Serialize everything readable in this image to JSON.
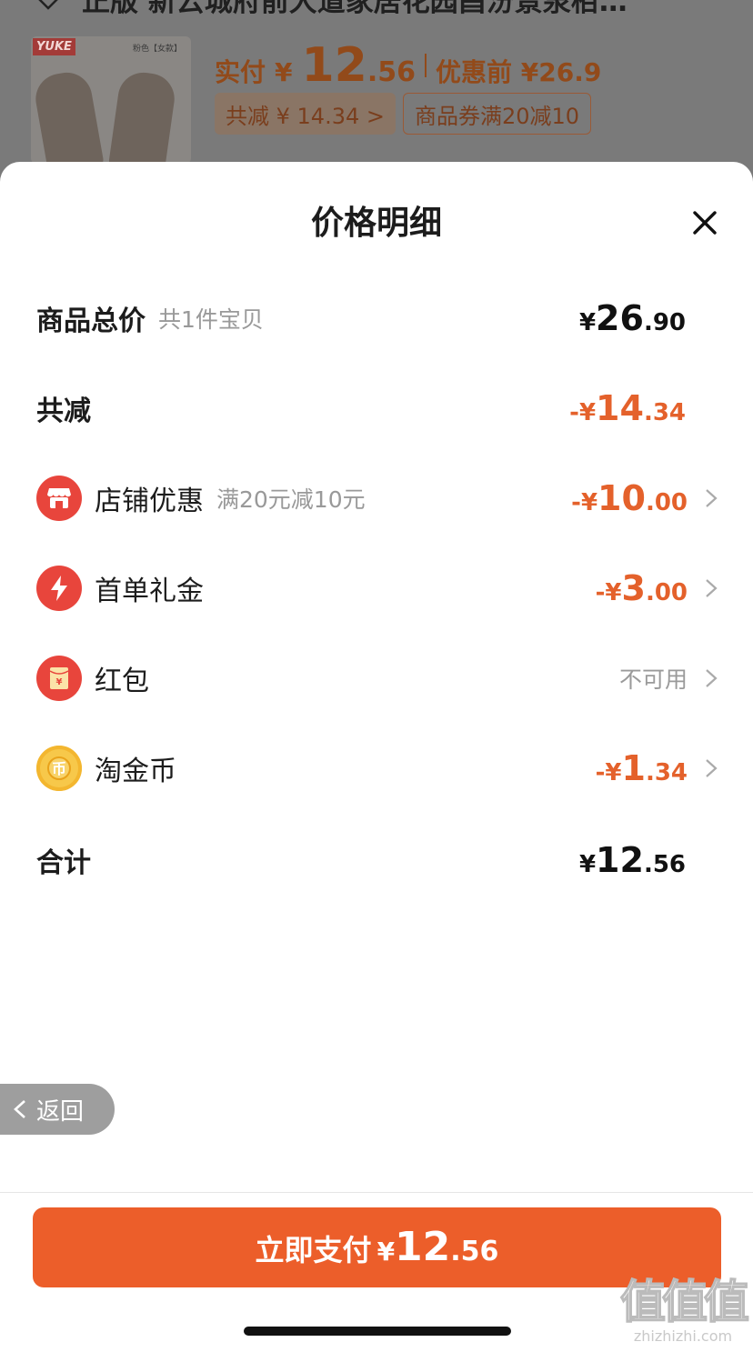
{
  "background": {
    "product_title": "正版 新云城府前大道家居花园昌汾景泉栢…",
    "brand": "YUKE",
    "thumb_label": "粉色【女款】",
    "price_label": "实付",
    "price_currency": "¥",
    "price_int": "12",
    "price_dec": ".56",
    "original_price": "优惠前 ¥26.9",
    "tags": [
      "共减 ¥ 14.34 >",
      "商品券满20减10"
    ]
  },
  "sheet": {
    "title": "价格明细",
    "close_icon": "close-icon",
    "rows": {
      "total": {
        "label": "商品总价",
        "sub": "共1件宝贝",
        "cur": "¥",
        "int": "26",
        "dec": ".90"
      },
      "discount": {
        "label": "共减",
        "cur": "-¥",
        "int": "14",
        "dec": ".34"
      },
      "shop": {
        "label": "店铺优惠",
        "sub": "满20元减10元",
        "cur": "-¥",
        "int": "10",
        "dec": ".00",
        "icon": "shop-icon"
      },
      "first_order": {
        "label": "首单礼金",
        "cur": "-¥",
        "int": "3",
        "dec": ".00",
        "icon": "lightning-icon"
      },
      "red_packet": {
        "label": "红包",
        "value": "不可用",
        "icon": "red-packet-icon"
      },
      "coin": {
        "label": "淘金币",
        "cur": "-¥",
        "int": "1",
        "dec": ".34",
        "icon": "coin-icon"
      },
      "sum": {
        "label": "合计",
        "cur": "¥",
        "int": "12",
        "dec": ".56"
      }
    },
    "back_label": "返回",
    "pay": {
      "label": "立即支付",
      "cur": "¥",
      "int": "12",
      "dec": ".56"
    }
  },
  "watermark": {
    "big": "值值值",
    "small": "zhizhizhi.com"
  },
  "colors": {
    "accent": "#ec5e2a",
    "discount_text": "#e4612b",
    "icon_red": "#e8453c",
    "coin_gold": "#f5b330"
  }
}
